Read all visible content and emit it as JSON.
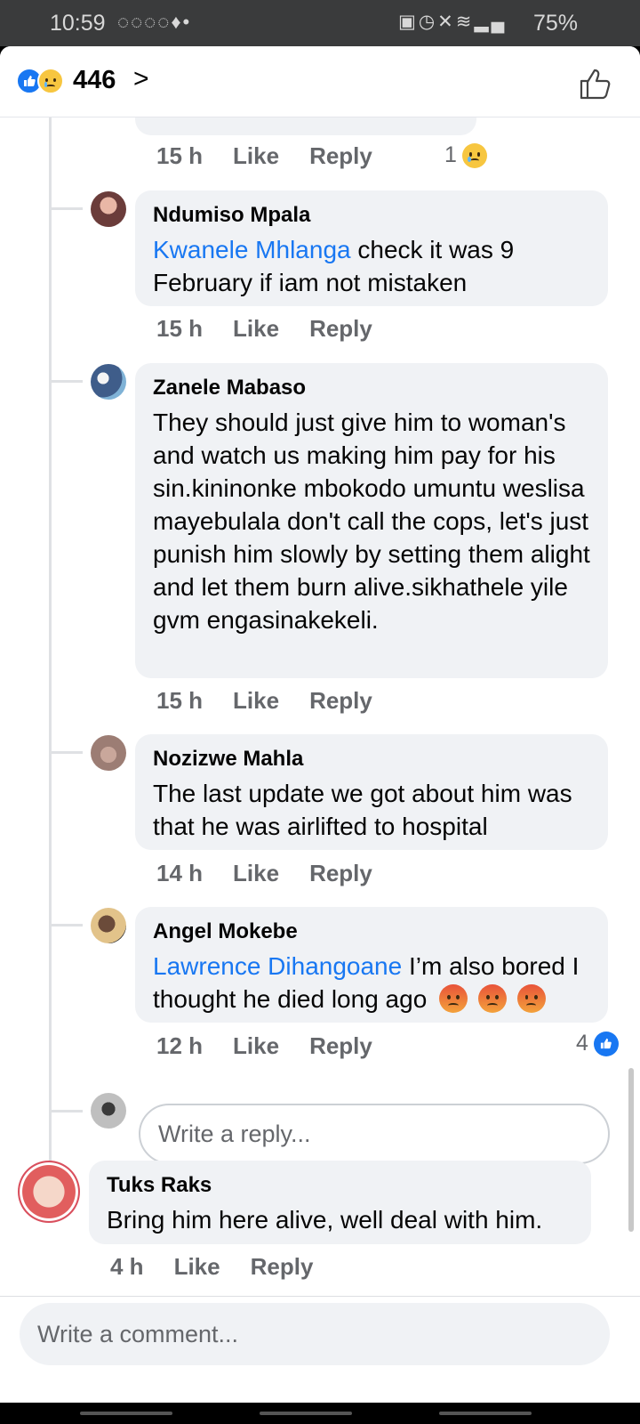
{
  "status_bar": {
    "time": "10:59",
    "notification_icons": [
      "messenger-icon",
      "messenger-icon",
      "messenger-icon",
      "messenger-icon",
      "app-icon",
      "dot-icon"
    ],
    "system_icons": [
      "alarm-icon",
      "alarm-clock-icon",
      "mute-icon",
      "wifi-icon",
      "signal-icon"
    ],
    "battery": "75%"
  },
  "header": {
    "reaction_icons": [
      "like-icon",
      "sad-icon"
    ],
    "reaction_count": "446",
    "accent": "#1877f2"
  },
  "comments": [
    {
      "time": "15 h",
      "like": "Like",
      "reply": "Reply",
      "reaction_count": "1",
      "reaction_icon": "sad-icon"
    },
    {
      "author": "Ndumiso Mpala",
      "mention": "Kwanele Mhlanga",
      "text": " check  it was  9 February  if iam not  mistaken",
      "time": "15 h",
      "like": "Like",
      "reply": "Reply"
    },
    {
      "author": "Zanele Mabaso",
      "text": "They should just give him to woman's and watch us making him pay for his sin.kininonke mbokodo umuntu weslisa mayebulala don't call the cops, let's just punish him slowly by setting them alight and let them burn alive.sikhathele yile gvm engasinakekeli.",
      "time": "15 h",
      "like": "Like",
      "reply": "Reply"
    },
    {
      "author": "Nozizwe Mahla",
      "text": "The last update we got about him was that he was airlifted to hospital",
      "time": "14 h",
      "like": "Like",
      "reply": "Reply"
    },
    {
      "author": "Angel Mokebe",
      "mention": "Lawrence Dihangoane",
      "text": " I’m also bored I thought he died long ago",
      "emojis": [
        "angry-icon",
        "angry-icon",
        "angry-icon"
      ],
      "time": "12 h",
      "like": "Like",
      "reply": "Reply",
      "reaction_count": "4",
      "reaction_icon": "like-icon"
    }
  ],
  "reply_input": {
    "placeholder": "Write a reply..."
  },
  "top_comment": {
    "author": "Tuks Raks",
    "text": "Bring him here alive, well deal with him.",
    "time": "4 h",
    "like": "Like",
    "reply": "Reply"
  },
  "comment_input": {
    "placeholder": "Write a comment..."
  }
}
